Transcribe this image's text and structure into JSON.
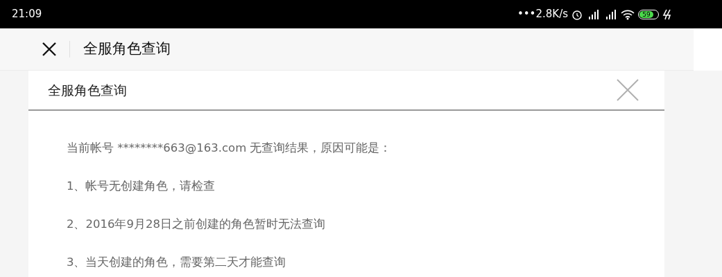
{
  "status_bar": {
    "time": "21:09",
    "network_speed": "•••2.8K/s",
    "battery": "59"
  },
  "app_bar": {
    "title": "全服角色查询"
  },
  "dialog": {
    "title": "全服角色查询",
    "lines": [
      "当前帐号 ********663@163.com 无查询结果，原因可能是：",
      "1、帐号无创建角色，请检查",
      "2、2016年9月28日之前创建的角色暂时无法查询",
      "3、当天创建的角色，需要第二天才能查询"
    ]
  }
}
